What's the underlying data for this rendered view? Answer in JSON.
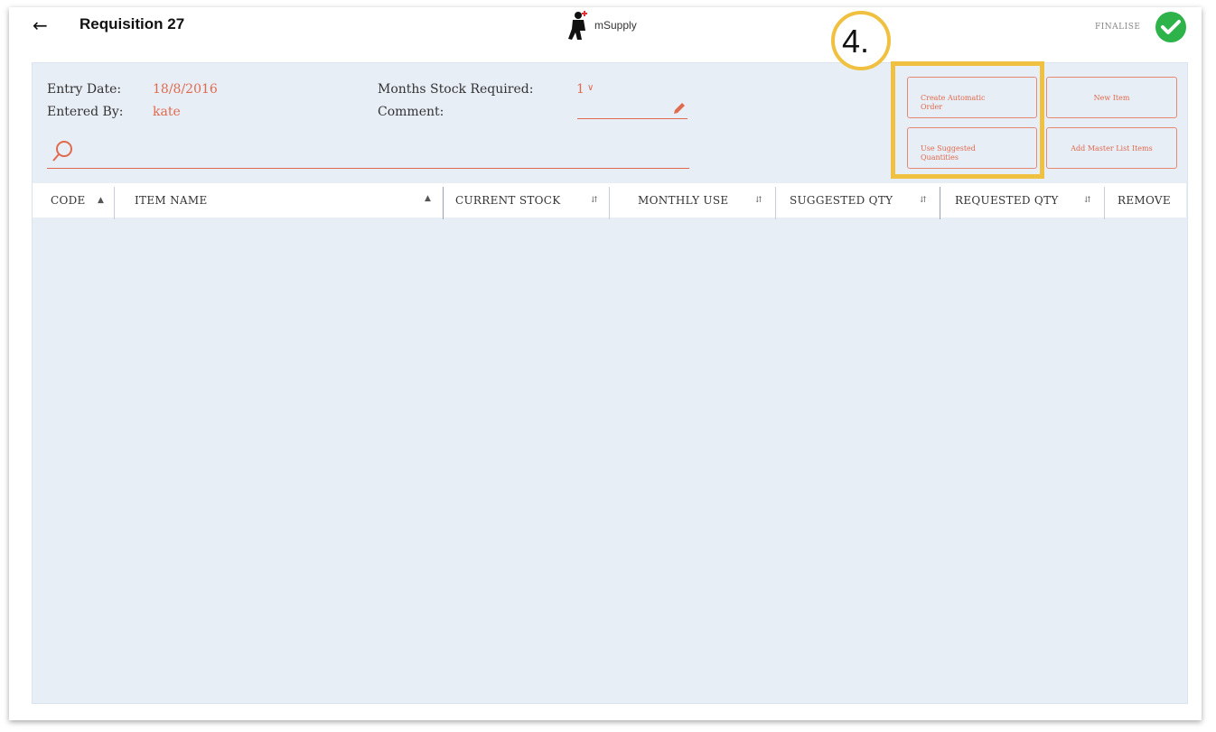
{
  "header": {
    "title": "Requisition 27",
    "logo_text": "mSupply",
    "finalise_label": "FINALISE"
  },
  "details": {
    "entry_date_label": "Entry Date:",
    "entry_date_value": "18/8/2016",
    "entered_by_label": "Entered By:",
    "entered_by_value": "kate",
    "months_label": "Months Stock Required:",
    "months_value": "1",
    "comment_label": "Comment:"
  },
  "buttons": {
    "create_auto_order_line1": "Create Automatic",
    "create_auto_order_line2": "Order",
    "new_item": "New Item",
    "use_suggested_line1": "Use Suggested",
    "use_suggested_line2": "Quantities",
    "add_master_list": "Add Master List Items"
  },
  "annotation": {
    "step": "4."
  },
  "table": {
    "columns": [
      "CODE",
      "ITEM NAME",
      "CURRENT STOCK",
      "MONTHLY USE",
      "SUGGESTED QTY",
      "REQUESTED QTY",
      "REMOVE"
    ]
  },
  "colors": {
    "accent": "#e06a4e",
    "highlight": "#f0c040",
    "panel": "#e8eef6",
    "success": "#2eb24a"
  },
  "icons": [
    "back-arrow-icon",
    "mupply-logo-icon",
    "checkmark-circle-icon",
    "pencil-icon",
    "search-icon",
    "sort-icon",
    "sort-ascending-icon"
  ]
}
